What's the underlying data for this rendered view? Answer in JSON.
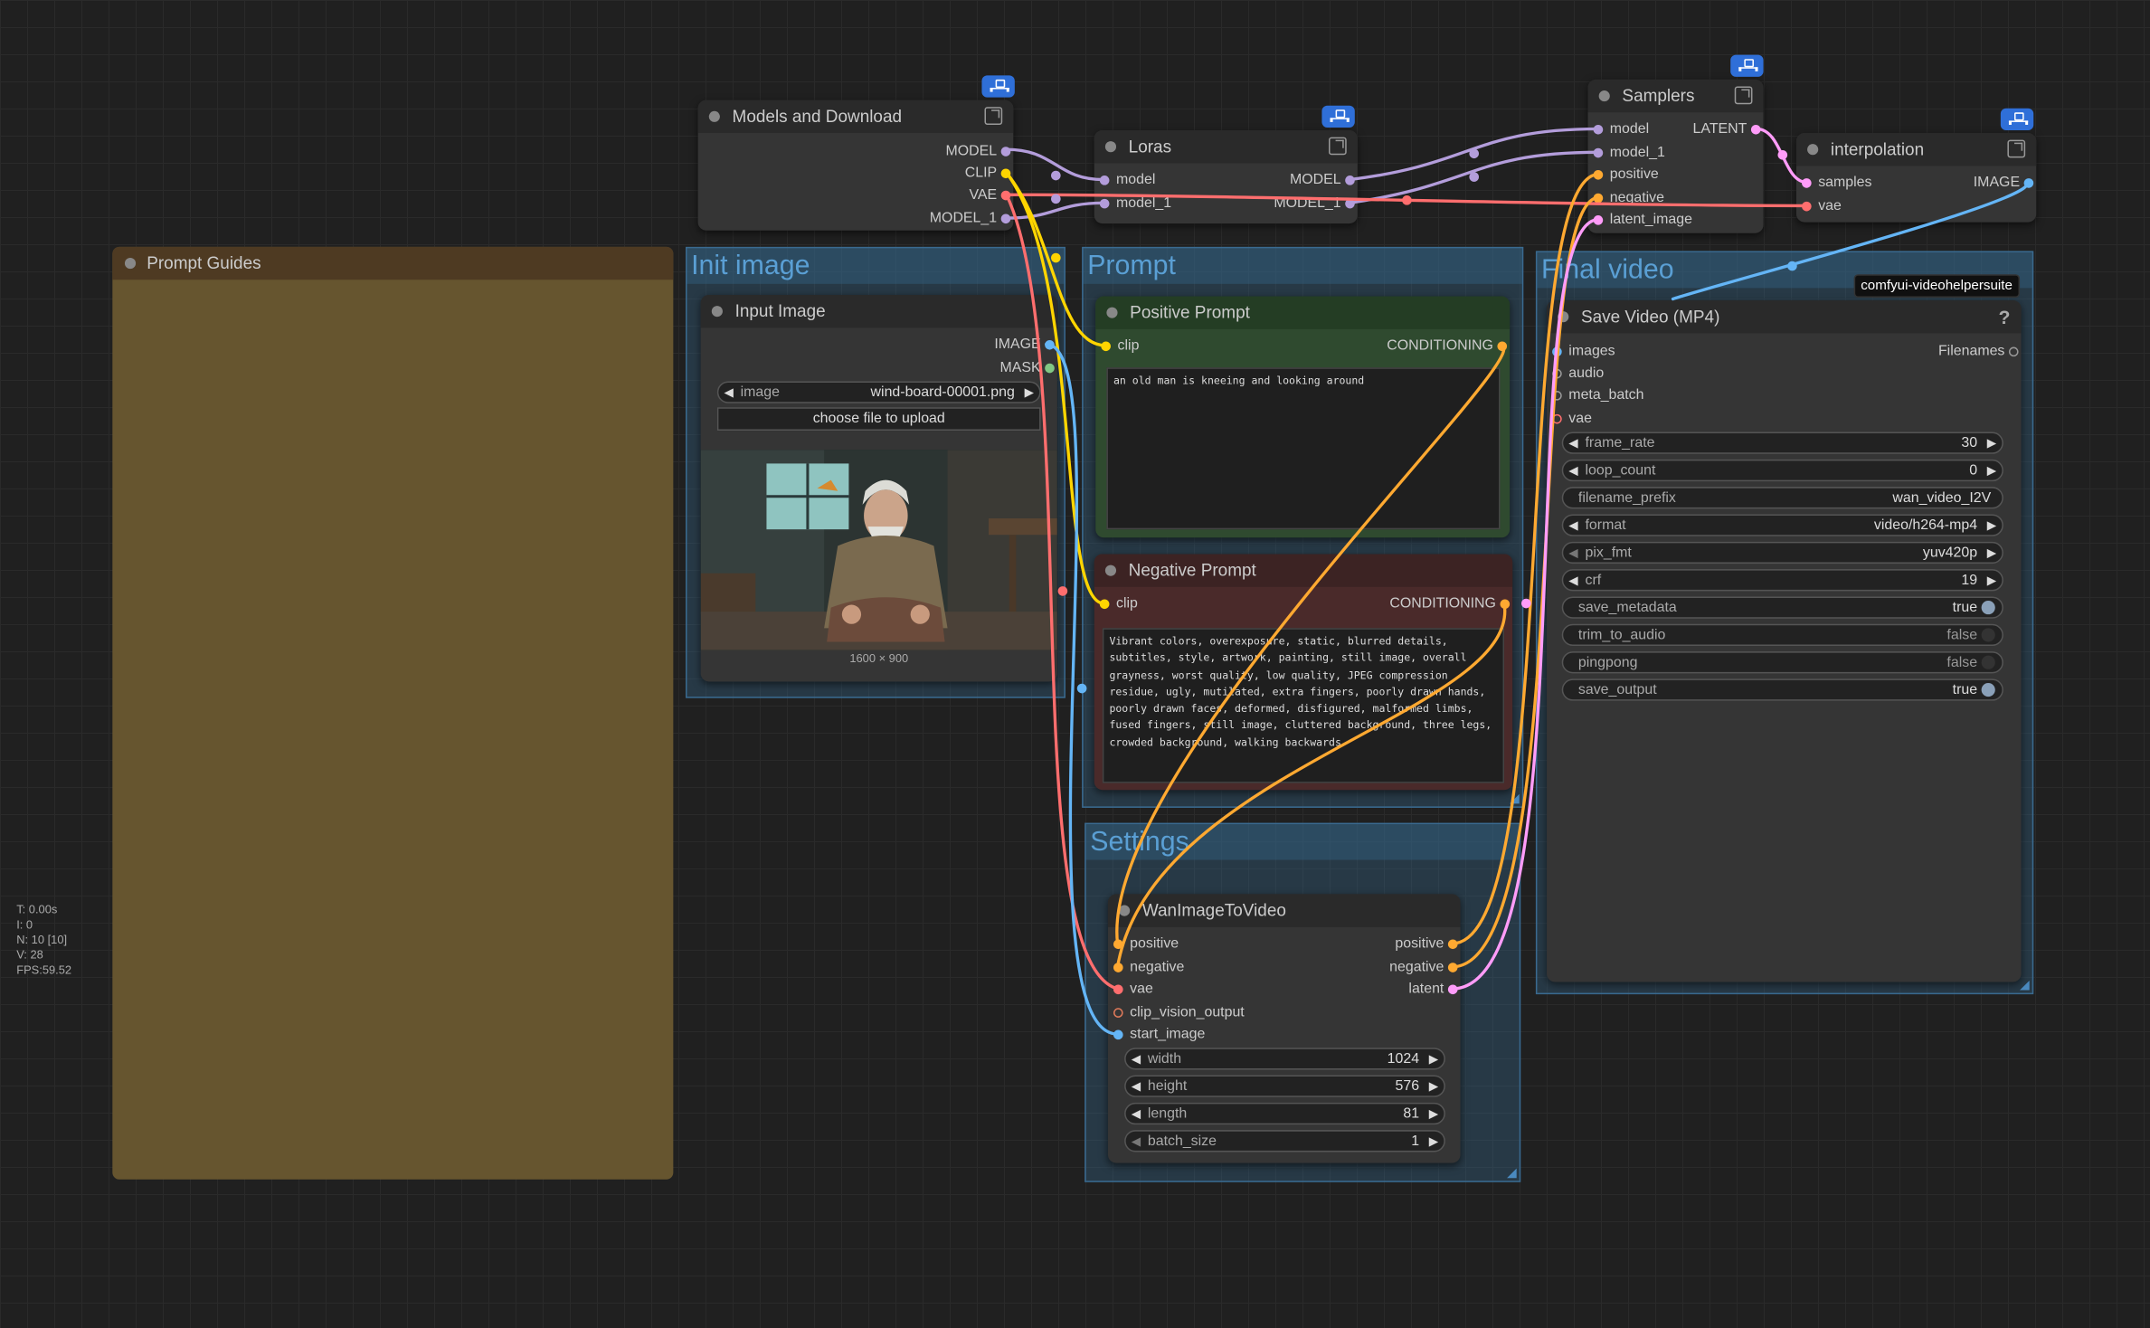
{
  "colors": {
    "model": "#b39ddb",
    "clip": "#ffd500",
    "vae": "#ff6e6e",
    "conditioning": "#ffa931",
    "latent": "#ff9cf9",
    "image": "#64b5f6",
    "mask": "#81c784",
    "group_blue": "#3a6a90",
    "prompt_guides_bg": "#66552f",
    "positive_node_bg": "#2f4a2f",
    "negative_node_bg": "#4a2a2a",
    "badge": "#2f6fd8"
  },
  "groups": {
    "prompt_guides": {
      "title": "Prompt Guides"
    },
    "init_image": {
      "title": "Init image"
    },
    "prompt": {
      "title": "Prompt"
    },
    "settings": {
      "title": "Settings"
    },
    "final_video": {
      "title": "Final video"
    }
  },
  "nodes": {
    "models_and_download": {
      "title": "Models and Download",
      "outputs": [
        "MODEL",
        "CLIP",
        "VAE",
        "MODEL_1"
      ]
    },
    "loras": {
      "title": "Loras",
      "inputs": [
        "model",
        "model_1"
      ],
      "outputs": [
        "MODEL",
        "MODEL_1"
      ]
    },
    "samplers": {
      "title": "Samplers",
      "inputs": [
        "model",
        "model_1",
        "positive",
        "negative",
        "latent_image"
      ],
      "outputs": [
        "LATENT"
      ]
    },
    "interpolation": {
      "title": "interpolation",
      "inputs": [
        "samples",
        "vae"
      ],
      "outputs": [
        "IMAGE"
      ]
    },
    "input_image": {
      "title": "Input Image",
      "outputs": [
        "IMAGE",
        "MASK"
      ],
      "image_widget": {
        "label": "image",
        "value": "wind-board-00001.png"
      },
      "upload_button": "choose file to upload",
      "image_size": "1600 × 900"
    },
    "positive_prompt": {
      "title": "Positive Prompt",
      "input": "clip",
      "output": "CONDITIONING",
      "text": "an old man is kneeing and looking around"
    },
    "negative_prompt": {
      "title": "Negative Prompt",
      "input": "clip",
      "output": "CONDITIONING",
      "text": "Vibrant colors, overexposure, static, blurred details, subtitles, style, artwork, painting, still image, overall grayness, worst quality, low quality, JPEG compression residue, ugly, mutilated, extra fingers, poorly drawn hands, poorly drawn faces, deformed, disfigured, malformed limbs, fused fingers, still image, cluttered background, three legs, crowded background, walking backwards"
    },
    "wan_image_to_video": {
      "title": "WanImageToVideo",
      "inputs": [
        "positive",
        "negative",
        "vae",
        "clip_vision_output",
        "start_image"
      ],
      "outputs": [
        "positive",
        "negative",
        "latent"
      ],
      "widgets": [
        {
          "label": "width",
          "value": "1024"
        },
        {
          "label": "height",
          "value": "576"
        },
        {
          "label": "length",
          "value": "81"
        },
        {
          "label": "batch_size",
          "value": "1"
        }
      ]
    },
    "save_video": {
      "title": "Save Video (MP4)",
      "help": "?",
      "inputs": [
        "images",
        "audio",
        "meta_batch",
        "vae"
      ],
      "outputs": [
        "Filenames"
      ],
      "widgets": [
        {
          "label": "frame_rate",
          "value": "30"
        },
        {
          "label": "loop_count",
          "value": "0"
        },
        {
          "label": "filename_prefix",
          "value": "wan_video_I2V"
        },
        {
          "label": "format",
          "value": "video/h264-mp4"
        },
        {
          "label": "pix_fmt",
          "value": "yuv420p"
        },
        {
          "label": "crf",
          "value": "19"
        },
        {
          "label": "save_metadata",
          "value": "true"
        },
        {
          "label": "trim_to_audio",
          "value": "false"
        },
        {
          "label": "pingpong",
          "value": "false"
        },
        {
          "label": "save_output",
          "value": "true"
        }
      ]
    }
  },
  "tooltip": "comfyui-videohelpersuite",
  "stats": {
    "time": "T: 0.00s",
    "iterations": "I: 0",
    "nodes": "N: 10 [10]",
    "vertices": "V: 28",
    "fps": "FPS:59.52"
  }
}
